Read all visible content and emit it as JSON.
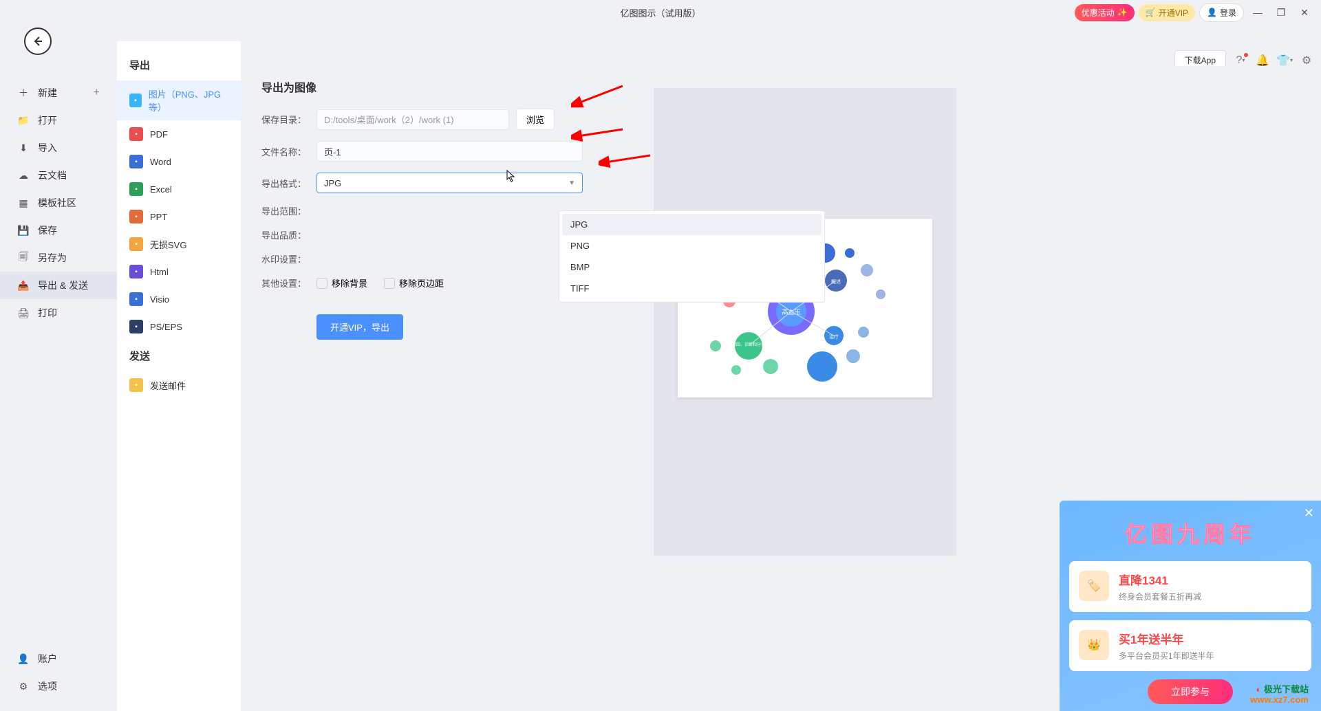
{
  "title": "亿图图示（试用版）",
  "topbar": {
    "promo": "优惠活动",
    "vip": "开通VIP",
    "login": "登录",
    "download": "下载App"
  },
  "sidebar1": {
    "items": [
      {
        "icon": "plus",
        "label": "新建",
        "plus": true
      },
      {
        "icon": "folder",
        "label": "打开"
      },
      {
        "icon": "import",
        "label": "导入"
      },
      {
        "icon": "cloud",
        "label": "云文档"
      },
      {
        "icon": "templates",
        "label": "模板社区"
      },
      {
        "icon": "save",
        "label": "保存"
      },
      {
        "icon": "saveas",
        "label": "另存为"
      },
      {
        "icon": "export",
        "label": "导出 & 发送",
        "active": true
      },
      {
        "icon": "print",
        "label": "打印"
      }
    ],
    "bottom": [
      {
        "icon": "user",
        "label": "账户"
      },
      {
        "icon": "gear",
        "label": "选项"
      }
    ]
  },
  "sidebar2": {
    "head_export": "导出",
    "head_send": "发送",
    "export_items": [
      {
        "label": "图片（PNG、JPG等）",
        "color": "#3bb4ff",
        "sel": true
      },
      {
        "label": "PDF",
        "color": "#e84e4e"
      },
      {
        "label": "Word",
        "color": "#3a6fd8"
      },
      {
        "label": "Excel",
        "color": "#2e9e5b"
      },
      {
        "label": "PPT",
        "color": "#e36a3a"
      },
      {
        "label": "无损SVG",
        "color": "#f2a53c"
      },
      {
        "label": "Html",
        "color": "#6a4ed8"
      },
      {
        "label": "Visio",
        "color": "#3a6fd8"
      },
      {
        "label": "PS/EPS",
        "color": "#2c3f66"
      }
    ],
    "send_items": [
      {
        "label": "发送邮件",
        "color": "#f2c24a"
      }
    ]
  },
  "form": {
    "heading": "导出为图像",
    "label_dir": "保存目录：",
    "dir_value": "D:/tools/桌面/work（2）/work (1)",
    "browse": "浏览",
    "label_filename": "文件名称：",
    "filename_value": "页-1",
    "label_format": "导出格式：",
    "format_value": "JPG",
    "format_options": [
      "JPG",
      "PNG",
      "BMP",
      "TIFF"
    ],
    "label_range": "导出范围：",
    "label_quality": "导出品质：",
    "label_watermark": "水印设置：",
    "label_other": "其他设置：",
    "chk_removebg": "移除背景",
    "chk_removepad": "移除页边距",
    "export_btn": "开通VIP，导出"
  },
  "promo_popup": {
    "title": "亿图九周年",
    "card1_h": "直降1341",
    "card1_s": "终身会员套餐五折再减",
    "card2_h": "买1年送半年",
    "card2_s": "多平台会员买1年即送半年",
    "btn": "立即参与"
  },
  "watermark": {
    "line1": "极光下载站",
    "line2": "www.xz7.com"
  }
}
